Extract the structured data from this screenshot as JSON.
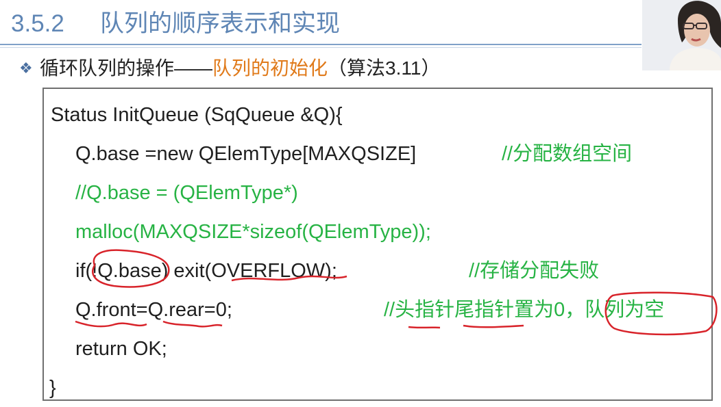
{
  "title": {
    "number": "3.5.2",
    "text": "队列的顺序表示和实现"
  },
  "bullet": {
    "prefix": "循环队列的操作——",
    "highlight": "队列的初始化",
    "suffix": "（算法3.11）"
  },
  "code": {
    "lines": [
      "Status InitQueue (SqQueue &Q){",
      "Q.base =new QElemType[MAXQSIZE]",
      "//Q.base = (QElemType*)",
      "malloc(MAXQSIZE*sizeof(QElemType));",
      "if(!Q.base) exit(OVERFLOW);",
      "Q.front=Q.rear=0;",
      "return OK;",
      "}"
    ],
    "comments": {
      "line1": "//分配数组空间",
      "line4": "//存储分配失败",
      "line5": "//头指针尾指针置为0，队列为空"
    }
  },
  "colors": {
    "title": "#5f86b5",
    "highlight": "#e07a1a",
    "comment": "#27b344",
    "annotation": "#d8232a"
  }
}
